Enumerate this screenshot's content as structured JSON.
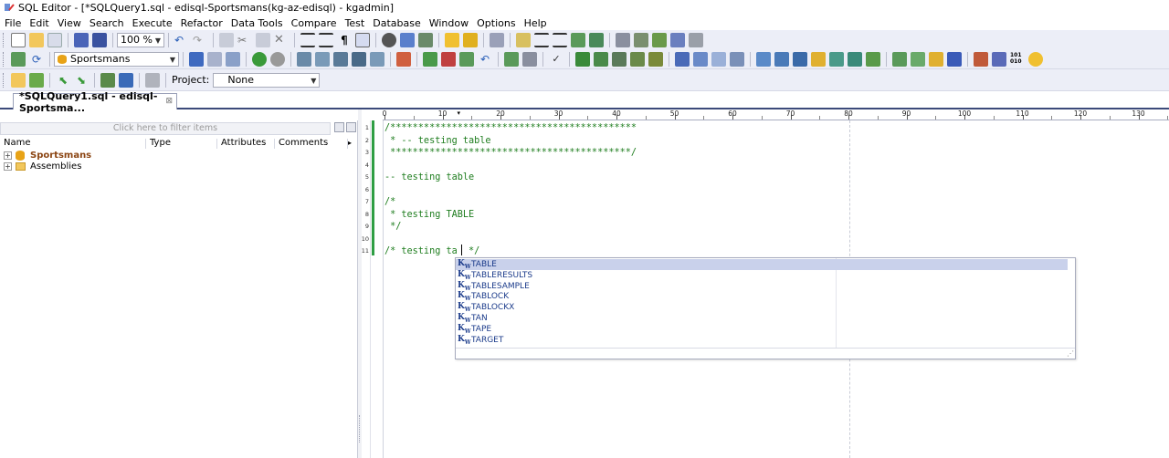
{
  "window": {
    "title": "SQL Editor - [*SQLQuery1.sql - edisql-Sportsmans(kg-az-edisql) - kgadmin]"
  },
  "menu": [
    "File",
    "Edit",
    "View",
    "Search",
    "Execute",
    "Refactor",
    "Data Tools",
    "Compare",
    "Test",
    "Database",
    "Window",
    "Options",
    "Help"
  ],
  "toolbar": {
    "zoom_value": "100 %",
    "database_value": "Sportsmans",
    "project_label": "Project:",
    "project_value": "None"
  },
  "tab": {
    "label": "*SQLQuery1.sql - edisql-Sportsma...",
    "close": "⊠"
  },
  "explorer": {
    "filter_placeholder": "Click here to filter items",
    "columns": [
      "Name",
      "Type",
      "Attributes",
      "Comments"
    ],
    "tree": [
      {
        "label": "Sportsmans",
        "expander": "+",
        "icon": "database-icon"
      },
      {
        "label": "Assemblies",
        "expander": "+",
        "icon": "folder-icon"
      }
    ]
  },
  "ruler": {
    "labels": [
      "0",
      "10",
      "20",
      "30",
      "40",
      "50",
      "60",
      "70",
      "80",
      "90",
      "100",
      "110",
      "120",
      "130"
    ]
  },
  "editor": {
    "line_numbers": [
      "1",
      "2",
      "3",
      "4",
      "5",
      "6",
      "7",
      "8",
      "9",
      "10",
      "11"
    ],
    "lines": [
      "/********************************************",
      " * -- testing table",
      " *******************************************/",
      "",
      "-- testing table",
      "",
      "/*",
      " * testing TABLE",
      " */",
      "",
      "/* testing ta  */"
    ]
  },
  "completion": {
    "badge": "K",
    "badge_sub": "W",
    "items": [
      "TABLE",
      "TABLERESULTS",
      "TABLESAMPLE",
      "TABLOCK",
      "TABLOCKX",
      "TAN",
      "TAPE",
      "TARGET"
    ],
    "selected_index": 0
  },
  "colors": {
    "code_comment": "#1e7d1e",
    "completion_text": "#1a3a8a",
    "selection": "#c9d1eb",
    "change_bar": "#2f9e44"
  }
}
